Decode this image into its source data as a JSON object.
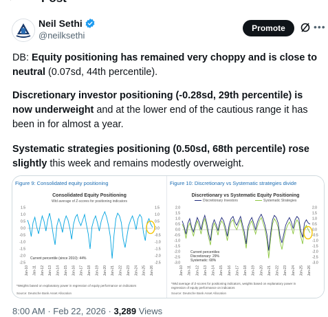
{
  "header": {
    "title": "Post"
  },
  "author": {
    "name": "Neil Sethi",
    "handle": "@neilksethi"
  },
  "actions": {
    "promote_label": "Promote"
  },
  "post": {
    "p1_a": "DB: ",
    "p1_b": "Equity positioning has remained very choppy and is close to neutral",
    "p1_c": " (0.07sd, 44th percentile).",
    "p2_a": "Discretionary investor positioning (-0.28sd, 29th percentile) is now underweight",
    "p2_b": " and at the lower end of the cautious range it has been in for almost a year.",
    "p3_a": "Systematic strategies positioning (0.50sd, 68th percentile) rose slightly",
    "p3_b": " this week and remains modestly overweight."
  },
  "meta": {
    "time": "8:00 AM",
    "date": "Feb 22, 2026",
    "views_count": "3,289",
    "views_label": "Views"
  },
  "colors": {
    "accent": "#1d9bf0",
    "left_series": "#00a3e0",
    "discretionary": "#1f2a7a",
    "systematic": "#8cc63f",
    "highlight": "#f5c400"
  },
  "chart_data": [
    {
      "type": "line",
      "fig_label": "Figure 9: Consolidated equity positioning",
      "title": "Consolidated Equity Positioning",
      "subtitle": "Wtd average of Z-scores for positioning indicators",
      "annotation": "Current percentile (since 2010): 44%",
      "footnote": "*Weights based on explanatory power in regression of equity performance on indicators",
      "source": "Source: Deutsche Bank Asset Allocation",
      "y_ticks": [
        "1.5",
        "1.0",
        "0.5",
        "0.0",
        "-0.5",
        "-1.0",
        "-1.5",
        "-2.0",
        "-2.5"
      ],
      "ylim": [
        -2.5,
        1.5
      ],
      "x_ticks": [
        "Jan-10",
        "Jan-11",
        "Jan-12",
        "Jan-13",
        "Jan-14",
        "Jan-15",
        "Jan-16",
        "Jan-17",
        "Jan-18",
        "Jan-19",
        "Jan-20",
        "Jan-21",
        "Jan-22",
        "Jan-23",
        "Jan-24",
        "Jan-25",
        "Jan-26"
      ],
      "series": [
        {
          "values": [
            0.6,
            0.2,
            -0.6,
            0.4,
            0.8,
            0.1,
            -0.4,
            0.3,
            0.9,
            0.5,
            -0.2,
            0.6,
            1.1,
            0.4,
            -0.5,
            -1.2,
            0.2,
            0.7,
            0.3,
            -0.3,
            0.5,
            0.9,
            0.6,
            0.0,
            -0.8,
            0.3,
            0.8,
            1.0,
            0.5,
            0.2,
            0.6,
            1.0,
            0.3,
            -0.4,
            -1.5,
            0.1,
            0.6,
            0.9,
            0.4,
            -0.2,
            0.5,
            0.9,
            1.2,
            0.8,
            0.2,
            -0.6,
            -2.2,
            -0.5,
            0.7,
            1.1,
            0.9,
            0.4,
            -0.8,
            -1.4,
            -0.6,
            0.2,
            0.6,
            0.9,
            0.5,
            -0.1,
            0.7,
            1.0,
            0.8,
            -0.3,
            -0.9,
            0.4,
            0.7,
            0.3,
            0.07
          ]
        }
      ]
    },
    {
      "type": "line",
      "fig_label": "Figure 10: Discretionary vs Systematic strategies divide",
      "title": "Discretionary vs Systematic Equity Positioning",
      "legend": [
        "Discretionary Investors",
        "Systematic Strategies"
      ],
      "annotation_lines": [
        "Current percentiles",
        "Discretionary: 29%",
        "Systematic: 68%"
      ],
      "footnote": "*Wtd average of Z-scores for positioning indicators, weights based on explanatory power in regression of equity performance on indicators",
      "source": "Source: Deutsche Bank Asset Allocation",
      "y_ticks": [
        "2.0",
        "1.5",
        "1.0",
        "0.5",
        "0.0",
        "-0.5",
        "-1.0",
        "-1.5",
        "-2.0",
        "-2.5",
        "-3.0"
      ],
      "ylim": [
        -3.0,
        2.0
      ],
      "x_ticks": [
        "Jan-10",
        "Jan-11",
        "Jan-12",
        "Jan-13",
        "Jan-14",
        "Jan-15",
        "Jan-16",
        "Jan-17",
        "Jan-18",
        "Jan-19",
        "Jan-20",
        "Jan-21",
        "Jan-22",
        "Jan-23",
        "Jan-24",
        "Jan-25",
        "Jan-26"
      ],
      "series": [
        {
          "name": "Discretionary Investors",
          "values": [
            0.5,
            0.1,
            -0.8,
            0.2,
            0.6,
            0.0,
            -0.6,
            0.2,
            0.8,
            0.3,
            -0.4,
            0.5,
            1.0,
            0.2,
            -0.7,
            -1.4,
            0.0,
            0.6,
            0.2,
            -0.5,
            0.4,
            0.8,
            0.5,
            -0.2,
            -1.0,
            0.1,
            0.7,
            0.9,
            0.3,
            0.0,
            0.5,
            0.9,
            0.1,
            -0.6,
            -1.7,
            -0.1,
            0.5,
            0.8,
            0.2,
            -0.4,
            0.3,
            0.8,
            1.1,
            0.6,
            0.0,
            -0.9,
            -2.6,
            -0.8,
            0.5,
            1.0,
            0.7,
            0.2,
            -1.1,
            -1.8,
            -0.9,
            -0.1,
            0.4,
            0.7,
            0.3,
            -0.4,
            0.5,
            0.9,
            0.6,
            -0.6,
            -1.3,
            0.1,
            0.4,
            0.0,
            -0.28
          ]
        },
        {
          "name": "Systematic Strategies",
          "values": [
            0.8,
            0.3,
            -0.4,
            0.6,
            1.0,
            0.2,
            -0.2,
            0.5,
            1.1,
            0.7,
            0.0,
            0.8,
            1.3,
            0.6,
            -0.3,
            -1.0,
            0.4,
            0.9,
            0.5,
            -0.1,
            0.7,
            1.1,
            0.8,
            0.2,
            -0.6,
            0.5,
            1.0,
            1.2,
            0.7,
            0.4,
            0.8,
            1.2,
            0.5,
            -0.2,
            -1.3,
            0.3,
            0.8,
            1.1,
            0.6,
            0.0,
            0.7,
            1.1,
            1.4,
            1.0,
            0.4,
            -0.4,
            -1.9,
            -0.3,
            0.9,
            1.3,
            1.1,
            0.6,
            -0.6,
            -1.2,
            -0.4,
            0.4,
            0.8,
            1.1,
            0.7,
            0.1,
            0.9,
            1.2,
            1.0,
            -0.1,
            -0.7,
            0.6,
            0.9,
            0.6,
            0.5
          ]
        }
      ]
    }
  ]
}
